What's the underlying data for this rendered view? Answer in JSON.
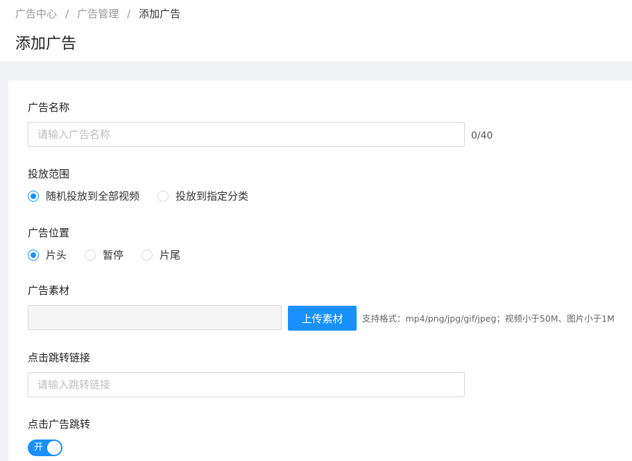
{
  "breadcrumb": {
    "items": [
      "广告中心",
      "广告管理",
      "添加广告"
    ],
    "separator": "/"
  },
  "page_title": "添加广告",
  "form": {
    "ad_name": {
      "label": "广告名称",
      "placeholder": "请输入广告名称",
      "value": "",
      "counter": "0/40"
    },
    "scope": {
      "label": "投放范围",
      "options": [
        "随机投放到全部视频",
        "投放到指定分类"
      ],
      "selected": "随机投放到全部视频"
    },
    "position": {
      "label": "广告位置",
      "options": [
        "片头",
        "暂停",
        "片尾"
      ],
      "selected": "片头"
    },
    "material": {
      "label": "广告素材",
      "upload_label": "上传素材",
      "hint": "支持格式：mp4/png/jpg/gif/jpeg；视频小于50M、图片小于1M"
    },
    "link": {
      "label": "点击跳转链接",
      "placeholder": "请输入跳转链接",
      "value": ""
    },
    "click_jump": {
      "label": "点击广告跳转",
      "switch_text": "开",
      "enabled": true
    }
  },
  "colors": {
    "primary": "#1890ff",
    "background": "#f0f2f5",
    "border": "#d9d9d9"
  }
}
